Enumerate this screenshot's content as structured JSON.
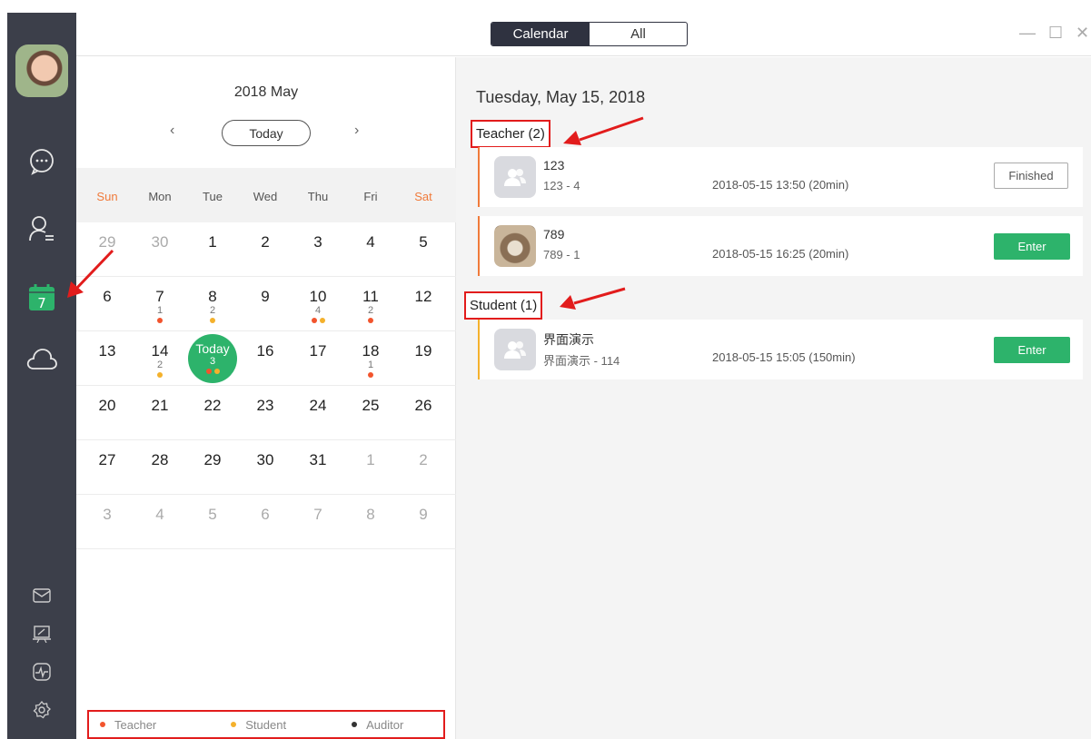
{
  "topbar": {
    "tabs": [
      {
        "label": "Calendar",
        "active": true
      },
      {
        "label": "All",
        "active": false
      }
    ],
    "window_controls": [
      "—",
      "☐",
      "✕"
    ]
  },
  "sidebar": {
    "items": [
      {
        "icon": "chat-bubble-icon"
      },
      {
        "icon": "contacts-icon"
      },
      {
        "icon": "calendar-icon",
        "label": "7",
        "active": true
      },
      {
        "icon": "cloud-icon"
      },
      {
        "icon": "mail-icon"
      },
      {
        "icon": "whiteboard-icon"
      },
      {
        "icon": "activity-icon"
      },
      {
        "icon": "settings-icon"
      }
    ]
  },
  "calendar": {
    "title": "2018 May",
    "prev": "‹",
    "next": "›",
    "today_button": "Today",
    "weekdays": [
      "Sun",
      "Mon",
      "Tue",
      "Wed",
      "Thu",
      "Fri",
      "Sat"
    ],
    "weeks": [
      [
        {
          "d": "29",
          "dim": true
        },
        {
          "d": "30",
          "dim": true
        },
        {
          "d": "1"
        },
        {
          "d": "2"
        },
        {
          "d": "3"
        },
        {
          "d": "4"
        },
        {
          "d": "5"
        }
      ],
      [
        {
          "d": "6"
        },
        {
          "d": "7",
          "count": "1",
          "dots": [
            "t"
          ]
        },
        {
          "d": "8",
          "count": "2",
          "dots": [
            "s"
          ]
        },
        {
          "d": "9"
        },
        {
          "d": "10",
          "count": "4",
          "dots": [
            "t",
            "s"
          ]
        },
        {
          "d": "11",
          "count": "2",
          "dots": [
            "t"
          ]
        },
        {
          "d": "12"
        }
      ],
      [
        {
          "d": "13"
        },
        {
          "d": "14",
          "count": "2",
          "dots": [
            "s"
          ]
        },
        {
          "d": "Today",
          "count": "3",
          "dots": [
            "t",
            "s"
          ],
          "today": true
        },
        {
          "d": "16"
        },
        {
          "d": "17"
        },
        {
          "d": "18",
          "count": "1",
          "dots": [
            "t"
          ]
        },
        {
          "d": "19"
        }
      ],
      [
        {
          "d": "20"
        },
        {
          "d": "21"
        },
        {
          "d": "22"
        },
        {
          "d": "23"
        },
        {
          "d": "24"
        },
        {
          "d": "25"
        },
        {
          "d": "26"
        }
      ],
      [
        {
          "d": "27"
        },
        {
          "d": "28"
        },
        {
          "d": "29"
        },
        {
          "d": "30"
        },
        {
          "d": "31"
        },
        {
          "d": "1",
          "dim": true
        },
        {
          "d": "2",
          "dim": true
        }
      ],
      [
        {
          "d": "3",
          "dim": true
        },
        {
          "d": "4",
          "dim": true
        },
        {
          "d": "5",
          "dim": true
        },
        {
          "d": "6",
          "dim": true
        },
        {
          "d": "7",
          "dim": true
        },
        {
          "d": "8",
          "dim": true
        },
        {
          "d": "9",
          "dim": true
        }
      ]
    ],
    "legend": [
      {
        "label": "Teacher",
        "color": "#f2542d"
      },
      {
        "label": "Student",
        "color": "#f4b12c"
      },
      {
        "label": "Auditor",
        "color": "#333333"
      }
    ]
  },
  "detail": {
    "date": "Tuesday, May 15, 2018",
    "teacher_header": "Teacher (2)",
    "student_header": "Student (1)",
    "teacher_classes": [
      {
        "title": "123",
        "sub": "123 - 4",
        "time": "2018-05-15 13:50 (20min)",
        "action": "Finished",
        "thumb": "group-icon"
      },
      {
        "title": "789",
        "sub": "789 - 1",
        "time": "2018-05-15 16:25 (20min)",
        "action": "Enter",
        "thumb": "photo"
      }
    ],
    "student_classes": [
      {
        "title": "界面演示",
        "sub": "界面演示 - 114",
        "time": "2018-05-15 15:05 (150min)",
        "action": "Enter",
        "thumb": "group-icon"
      }
    ]
  },
  "colors": {
    "sidebar": "#3c3f4a",
    "accent_green": "#2db36b",
    "teacher": "#f2542d",
    "student": "#f4b12c",
    "highlight_red": "#e21c1c"
  }
}
